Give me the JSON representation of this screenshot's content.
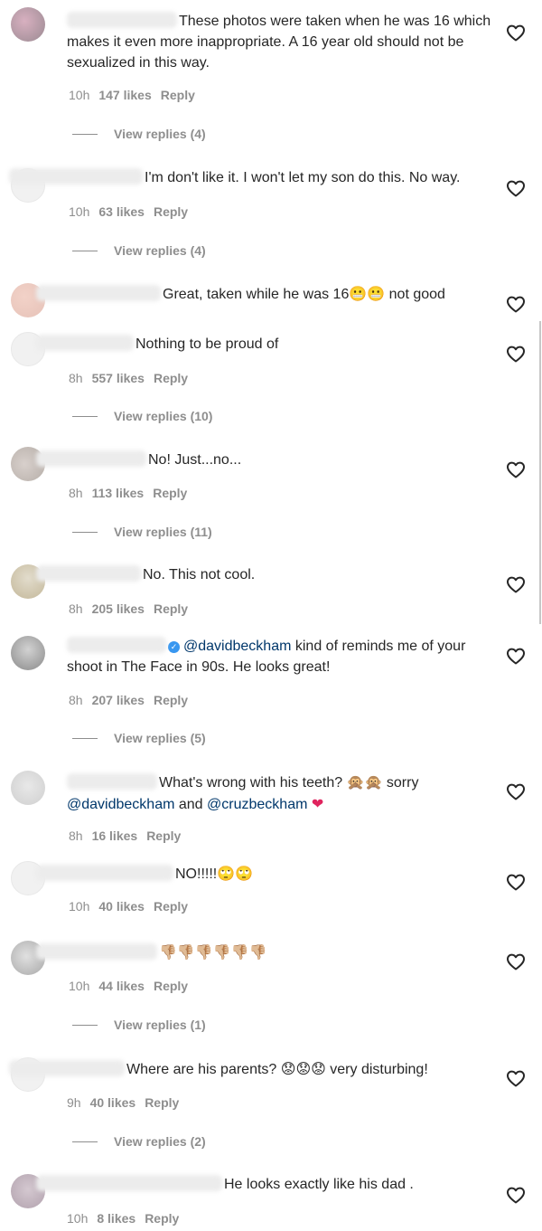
{
  "comments": [
    {
      "text": "These photos were taken when he was 16 which makes it even more inappropriate. A 16 year old should not be sexualized in this way.",
      "time": "10h",
      "likes": "147 likes",
      "reply": "Reply",
      "view_replies": "View replies (4)"
    },
    {
      "text": "I'm don't like it. I won't let my son do this. No way.",
      "time": "10h",
      "likes": "63 likes",
      "reply": "Reply",
      "view_replies": "View replies (4)"
    },
    {
      "text": "Great, taken while he was 16",
      "emojis": "😬😬",
      "text_after": "not good"
    },
    {
      "text": "Nothing to be proud of",
      "time": "8h",
      "likes": "557 likes",
      "reply": "Reply",
      "view_replies": "View replies (10)"
    },
    {
      "text": "No! Just...no...",
      "time": "8h",
      "likes": "113 likes",
      "reply": "Reply",
      "view_replies": "View replies (11)"
    },
    {
      "text": "No. This not cool.",
      "time": "8h",
      "likes": "205 likes",
      "reply": "Reply"
    },
    {
      "mention": "@davidbeckham",
      "text": "kind of reminds me of your shoot in The Face in 90s. He looks great!",
      "time": "8h",
      "likes": "207 likes",
      "reply": "Reply",
      "view_replies": "View replies (5)"
    },
    {
      "text": "What's wrong with his teeth?",
      "emojis": "🙊🙊",
      "text_mid": "sorry",
      "mention1": "@davidbeckham",
      "and": "and",
      "mention2": "@cruzbeckham",
      "heart_emoji": "❤",
      "time": "8h",
      "likes": "16 likes",
      "reply": "Reply"
    },
    {
      "text": "NO!!!!!",
      "emojis": "🙄🙄",
      "time": "10h",
      "likes": "40 likes",
      "reply": "Reply"
    },
    {
      "emojis": "👎🏼👎🏼👎🏼👎🏼👎🏼👎🏼",
      "time": "10h",
      "likes": "44 likes",
      "reply": "Reply",
      "view_replies": "View replies (1)"
    },
    {
      "text": "Where are his parents?",
      "emojis": "😟😟😟",
      "text_after": "very disturbing!",
      "time": "9h",
      "likes": "40 likes",
      "reply": "Reply",
      "view_replies": "View replies (2)"
    },
    {
      "text": "He looks exactly like his dad .",
      "time": "10h",
      "likes": "8 likes",
      "reply": "Reply"
    }
  ],
  "colors": {
    "text": "#262626",
    "meta": "#8e8e8e",
    "mention": "#00376b",
    "verified": "#3897f0",
    "heart_emoji": "#e0245e"
  },
  "icons": {
    "like": "heart-outline-icon",
    "verified": "verified-badge-icon"
  }
}
